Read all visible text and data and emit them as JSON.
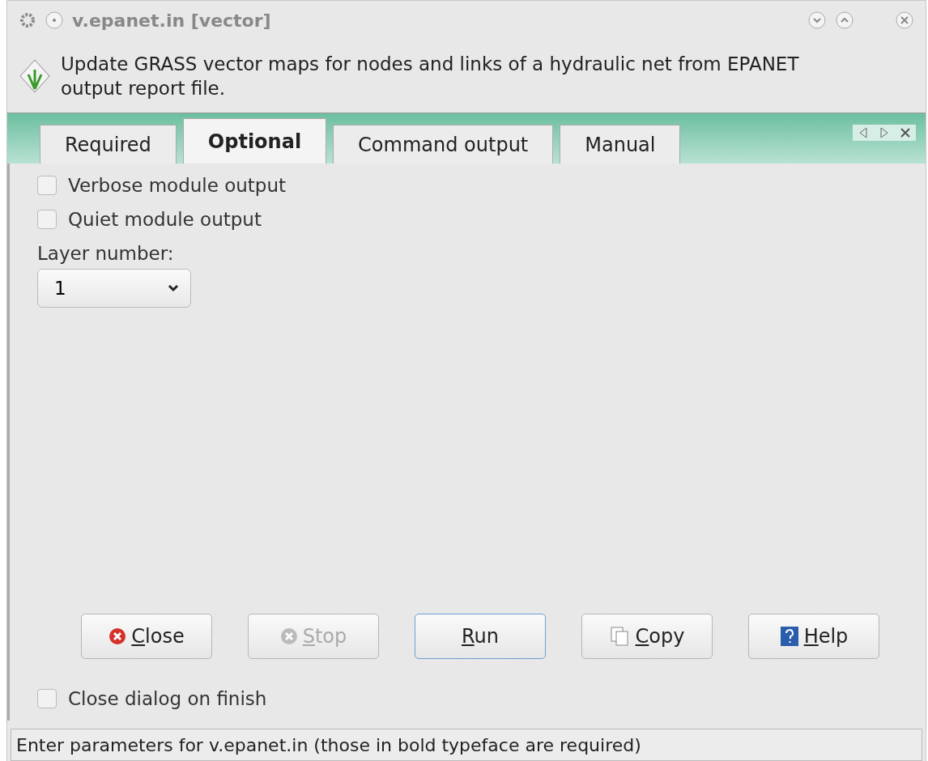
{
  "window": {
    "title": "v.epanet.in [vector]"
  },
  "description": "Update GRASS vector maps for nodes and links of a hydraulic net from EPANET output report file.",
  "tabs": [
    {
      "label": "Required",
      "selected": false
    },
    {
      "label": "Optional",
      "selected": true
    },
    {
      "label": "Command output",
      "selected": false
    },
    {
      "label": "Manual",
      "selected": false
    }
  ],
  "options": [
    {
      "label": "Verbose module output",
      "checked": false
    },
    {
      "label": "Quiet module output",
      "checked": false
    }
  ],
  "layer": {
    "label": "Layer number:",
    "value": "1"
  },
  "buttons": [
    {
      "kind": "close",
      "label": "Close",
      "disabled": false,
      "focused": false
    },
    {
      "kind": "stop",
      "label": "Stop",
      "disabled": true,
      "focused": false
    },
    {
      "kind": "run",
      "label": "Run",
      "disabled": false,
      "focused": true
    },
    {
      "kind": "copy",
      "label": "Copy",
      "disabled": false,
      "focused": false
    },
    {
      "kind": "help",
      "label": "Help",
      "disabled": false,
      "focused": false
    }
  ],
  "close_on_finish": {
    "label": "Close dialog on finish",
    "checked": false
  },
  "status_bar": "Enter parameters for v.epanet.in (those in bold typeface are required)"
}
